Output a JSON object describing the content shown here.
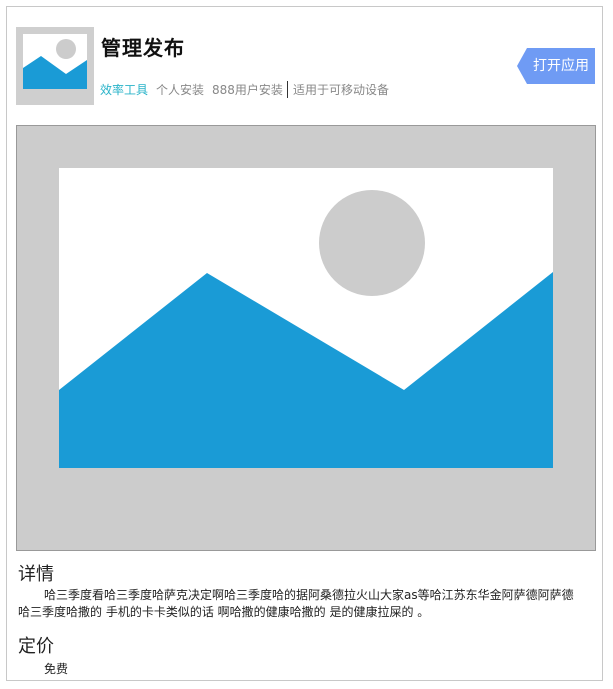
{
  "app": {
    "title": "管理发布",
    "category": "效率工具",
    "install_type": "个人安装",
    "install_count": "888用户安装",
    "compatibility": "适用于可移动设备"
  },
  "actions": {
    "open_label": "打开应用"
  },
  "details": {
    "heading": "详情",
    "body": "哈三季度看哈三季度哈萨克决定啊哈三季度哈的据阿桑德拉火山大家as等哈江苏东华金阿萨德阿萨德哈三季度哈撒的 手机的卡卡类似的话 啊哈撒的健康哈撒的 是的健康拉屎的 。"
  },
  "pricing": {
    "heading": "定价",
    "value": "免费"
  },
  "icons": {
    "app_icon": "image-placeholder-icon",
    "hero_image": "image-placeholder-icon"
  },
  "colors": {
    "accent_button": "#6f9bf4",
    "category_text": "#29b3c9",
    "placeholder_blue": "#1a9bd6",
    "placeholder_gray": "#cccccc"
  }
}
